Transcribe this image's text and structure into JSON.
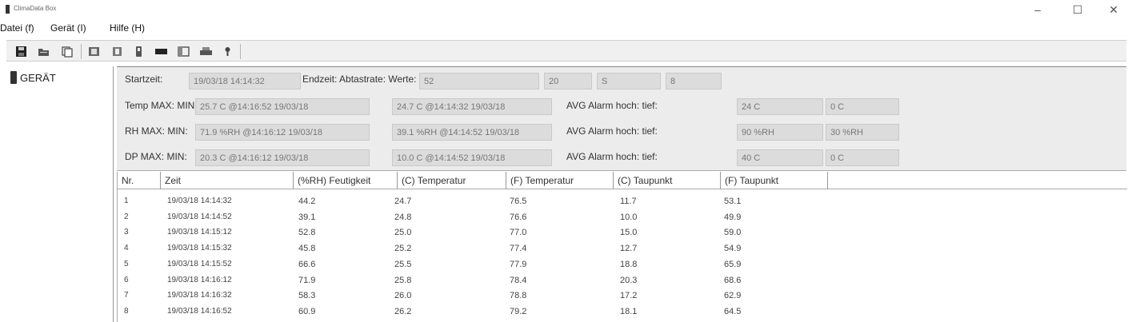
{
  "window": {
    "title": "ClimaData Box",
    "controls": [
      "–",
      "☐",
      "✕"
    ]
  },
  "menu": [
    "Datei (f)",
    "Gerät (I)",
    "Hilfe (H)"
  ],
  "toolbar": {
    "icons": [
      "save-icon",
      "open-icon",
      "copy-icon",
      "export-icon",
      "import-icon",
      "logger-icon",
      "battery-icon",
      "window-icon",
      "print-icon",
      "info-icon"
    ]
  },
  "tree": {
    "device_label": "GERÄT"
  },
  "info": {
    "startzeit_label": "Startzeit:",
    "startzeit_value": "19/03/18 14:14:32",
    "endzeit_label": "Endzeit: Abtastrate: Werte:",
    "endzeit_value": "52",
    "abtastrate_value": "20",
    "abtastrate_unit": "S",
    "werte_value": "8",
    "temp": {
      "label": "Temp MAX: MIN:",
      "max": "25.7 C @14:16:52 19/03/18",
      "min": "24.7 C @14:14:32 19/03/18",
      "alarm_label": "AVG Alarm hoch: tief:",
      "alarm_high": "24 C",
      "alarm_low": "0 C"
    },
    "rh": {
      "label": "RH MAX: MIN:",
      "max": "71.9 %RH @14:16:12 19/03/18",
      "min": "39.1 %RH @14:14:52 19/03/18",
      "alarm_label": "AVG Alarm hoch: tief:",
      "alarm_high": "90 %RH",
      "alarm_low": "30 %RH"
    },
    "dp": {
      "label": "DP MAX: MIN:",
      "max": "20.3 C @14:16:12 19/03/18",
      "min": "10.0 C @14:14:52 19/03/18",
      "alarm_label": "AVG Alarm hoch: tief:",
      "alarm_high": "40 C",
      "alarm_low": "0 C"
    }
  },
  "table": {
    "headers": [
      "Nr.",
      "Zeit",
      "(%RH) Feutigkeit",
      "(C) Temperatur",
      "(F) Temperatur",
      "(C) Taupunkt",
      "(F) Taupunkt"
    ],
    "rows": [
      [
        "1",
        "19/03/18 14:14:32",
        "44.2",
        "24.7",
        "76.5",
        "11.7",
        "53.1"
      ],
      [
        "2",
        "19/03/18 14:14:52",
        "39.1",
        "24.8",
        "76.6",
        "10.0",
        "49.9"
      ],
      [
        "3",
        "19/03/18 14:15:12",
        "52.8",
        "25.0",
        "77.0",
        "15.0",
        "59.0"
      ],
      [
        "4",
        "19/03/18 14:15:32",
        "45.8",
        "25.2",
        "77.4",
        "12.7",
        "54.9"
      ],
      [
        "5",
        "19/03/18 14:15:52",
        "66.6",
        "25.5",
        "77.9",
        "18.8",
        "65.9"
      ],
      [
        "6",
        "19/03/18 14:16:12",
        "71.9",
        "25.8",
        "78.4",
        "20.3",
        "68.6"
      ],
      [
        "7",
        "19/03/18 14:16:32",
        "58.3",
        "26.0",
        "78.8",
        "17.2",
        "62.9"
      ],
      [
        "8",
        "19/03/18 14:16:52",
        "60.9",
        "26.2",
        "79.2",
        "18.1",
        "64.5"
      ]
    ]
  }
}
